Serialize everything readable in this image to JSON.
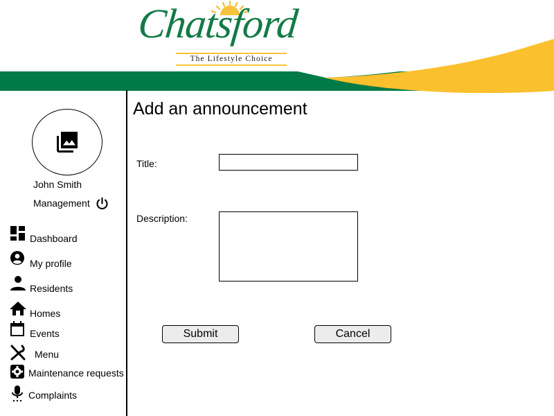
{
  "header": {
    "brand": "Chatsford",
    "tagline": "The Lifestyle Choice",
    "colors": {
      "green": "#007a46",
      "gold": "#fbc02d"
    }
  },
  "user": {
    "avatar_icon": "photo-library-icon",
    "name": "John Smith",
    "role": "Management",
    "logout_icon": "power-icon"
  },
  "sidebar": {
    "items": [
      {
        "label": "Dashboard",
        "icon": "dashboard-icon"
      },
      {
        "label": "My profile",
        "icon": "account-circle-icon"
      },
      {
        "label": "Residents",
        "icon": "person-icon"
      },
      {
        "label": "Homes",
        "icon": "home-icon"
      },
      {
        "label": "Events",
        "icon": "calendar-icon"
      },
      {
        "label": "Menu",
        "icon": "fork-knife-icon"
      },
      {
        "label": "Maintenance requests",
        "icon": "settings-icon"
      },
      {
        "label": "Complaints",
        "icon": "microphone-icon"
      }
    ]
  },
  "main": {
    "title": "Add an announcement",
    "form": {
      "title_label": "Title:",
      "title_value": "",
      "description_label": "Description:",
      "description_value": "",
      "submit_label": "Submit",
      "cancel_label": "Cancel"
    }
  }
}
